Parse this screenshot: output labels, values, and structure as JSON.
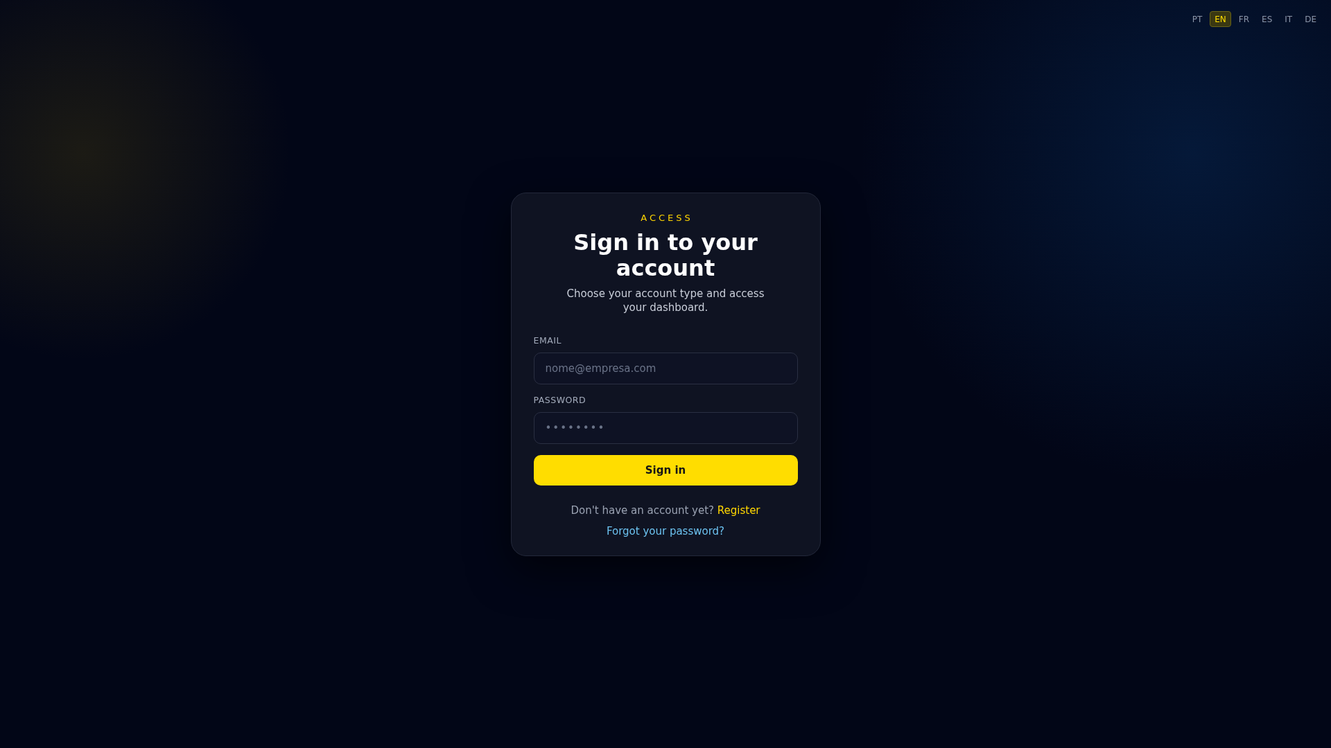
{
  "languages": [
    {
      "code": "PT",
      "selected": false
    },
    {
      "code": "EN",
      "selected": true
    },
    {
      "code": "FR",
      "selected": false
    },
    {
      "code": "ES",
      "selected": false
    },
    {
      "code": "IT",
      "selected": false
    },
    {
      "code": "DE",
      "selected": false
    }
  ],
  "card": {
    "eyebrow": "ACCESS",
    "title": "Sign in to your account",
    "subtitle": "Choose your account type and access your dashboard.",
    "fields": [
      {
        "kind": "email",
        "label": "EMAIL",
        "placeholder": "nome@empresa.com"
      },
      {
        "kind": "password",
        "label": "PASSWORD",
        "placeholder": "••••••••"
      }
    ],
    "submit": "Sign in",
    "register_prompt": "Don't have an account yet?",
    "register_link": "Register",
    "forgot_link": "Forgot your password?"
  }
}
